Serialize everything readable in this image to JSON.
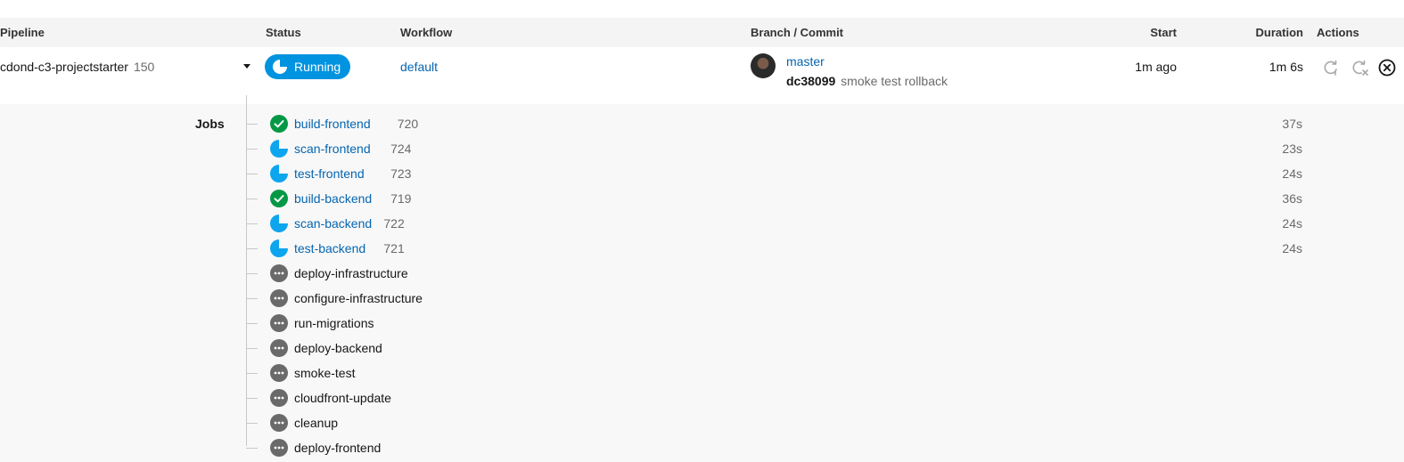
{
  "header": {
    "pipeline": "Pipeline",
    "status": "Status",
    "workflow": "Workflow",
    "branch_commit": "Branch / Commit",
    "start": "Start",
    "duration": "Duration",
    "actions": "Actions"
  },
  "pipeline": {
    "name": "cdond-c3-projectstarter",
    "number": "150",
    "status": "Running",
    "workflow": "default",
    "branch": "master",
    "commit_hash": "dc38099",
    "commit_message": "smoke test rollback",
    "start": "1m ago",
    "duration": "1m 6s",
    "status_color": "#0093e0",
    "actions": [
      "rerun-icon",
      "rerun-failed-icon",
      "cancel-icon"
    ]
  },
  "jobs_label": "Jobs",
  "jobs": [
    {
      "name": "build-frontend",
      "number": "720",
      "duration": "37s",
      "status": "success"
    },
    {
      "name": "scan-frontend",
      "number": "724",
      "duration": "23s",
      "status": "running"
    },
    {
      "name": "test-frontend",
      "number": "723",
      "duration": "24s",
      "status": "running"
    },
    {
      "name": "build-backend",
      "number": "719",
      "duration": "36s",
      "status": "success"
    },
    {
      "name": "scan-backend",
      "number": "722",
      "duration": "24s",
      "status": "running"
    },
    {
      "name": "test-backend",
      "number": "721",
      "duration": "24s",
      "status": "running"
    },
    {
      "name": "deploy-infrastructure",
      "number": "",
      "duration": "",
      "status": "pending"
    },
    {
      "name": "configure-infrastructure",
      "number": "",
      "duration": "",
      "status": "pending"
    },
    {
      "name": "run-migrations",
      "number": "",
      "duration": "",
      "status": "pending"
    },
    {
      "name": "deploy-backend",
      "number": "",
      "duration": "",
      "status": "pending"
    },
    {
      "name": "smoke-test",
      "number": "",
      "duration": "",
      "status": "pending"
    },
    {
      "name": "cloudfront-update",
      "number": "",
      "duration": "",
      "status": "pending"
    },
    {
      "name": "cleanup",
      "number": "",
      "duration": "",
      "status": "pending"
    },
    {
      "name": "deploy-frontend",
      "number": "",
      "duration": "",
      "status": "pending"
    }
  ],
  "colors": {
    "success": "#039845",
    "running": "#0ea5ef",
    "pending": "#6a6a6a",
    "link": "#0565b0"
  }
}
